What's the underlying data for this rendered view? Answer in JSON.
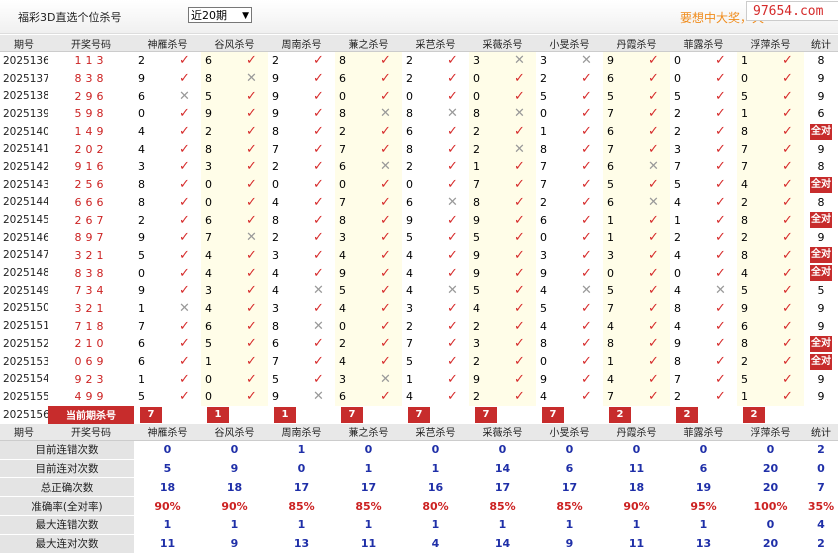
{
  "header": {
    "title": "福彩3D直选个位杀号",
    "range": "近20期",
    "slogan": "要想中大奖，天",
    "logo": "97654.com"
  },
  "columns": {
    "period": "期号",
    "number": "开奖号码",
    "stat": "统计",
    "methods": [
      "神雁杀号",
      "谷风杀号",
      "周南杀号",
      "蒹之杀号",
      "采芑杀号",
      "采薇杀号",
      "小旻杀号",
      "丹霞杀号",
      "菲露杀号",
      "浮萍杀号"
    ]
  },
  "rows": [
    {
      "period": "2025136",
      "number": "113",
      "values": [
        2,
        6,
        2,
        8,
        2,
        3,
        3,
        9,
        0,
        1
      ],
      "marks": [
        1,
        1,
        1,
        1,
        1,
        0,
        0,
        1,
        1,
        1
      ],
      "stat": "8"
    },
    {
      "period": "2025137",
      "number": "838",
      "values": [
        9,
        8,
        9,
        6,
        2,
        0,
        2,
        6,
        0,
        0
      ],
      "marks": [
        1,
        0,
        1,
        1,
        1,
        1,
        1,
        1,
        1,
        1
      ],
      "stat": "9"
    },
    {
      "period": "2025138",
      "number": "296",
      "values": [
        6,
        5,
        9,
        0,
        0,
        0,
        5,
        5,
        5,
        5
      ],
      "marks": [
        0,
        1,
        1,
        1,
        1,
        1,
        1,
        1,
        1,
        1
      ],
      "stat": "9"
    },
    {
      "period": "2025139",
      "number": "598",
      "values": [
        0,
        9,
        9,
        8,
        8,
        8,
        0,
        7,
        2,
        1
      ],
      "marks": [
        1,
        1,
        1,
        0,
        0,
        0,
        1,
        1,
        1,
        1
      ],
      "stat": "6"
    },
    {
      "period": "2025140",
      "number": "149",
      "values": [
        4,
        2,
        8,
        2,
        6,
        2,
        1,
        6,
        2,
        8
      ],
      "marks": [
        1,
        1,
        1,
        1,
        1,
        1,
        1,
        1,
        1,
        1
      ],
      "stat": "全对"
    },
    {
      "period": "2025141",
      "number": "202",
      "values": [
        4,
        8,
        7,
        7,
        8,
        2,
        8,
        7,
        3,
        7
      ],
      "marks": [
        1,
        1,
        1,
        1,
        1,
        0,
        1,
        1,
        1,
        1
      ],
      "stat": "9"
    },
    {
      "period": "2025142",
      "number": "916",
      "values": [
        3,
        3,
        2,
        6,
        2,
        1,
        7,
        6,
        7,
        7
      ],
      "marks": [
        1,
        1,
        1,
        0,
        1,
        1,
        1,
        0,
        1,
        1
      ],
      "stat": "8"
    },
    {
      "period": "2025143",
      "number": "256",
      "values": [
        8,
        0,
        0,
        0,
        0,
        7,
        7,
        5,
        5,
        4
      ],
      "marks": [
        1,
        1,
        1,
        1,
        1,
        1,
        1,
        1,
        1,
        1
      ],
      "stat": "全对"
    },
    {
      "period": "2025144",
      "number": "666",
      "values": [
        8,
        0,
        4,
        7,
        6,
        8,
        2,
        6,
        4,
        2
      ],
      "marks": [
        1,
        1,
        1,
        1,
        0,
        1,
        1,
        0,
        1,
        1
      ],
      "stat": "8"
    },
    {
      "period": "2025145",
      "number": "267",
      "values": [
        2,
        6,
        8,
        8,
        9,
        9,
        6,
        1,
        1,
        8
      ],
      "marks": [
        1,
        1,
        1,
        1,
        1,
        1,
        1,
        1,
        1,
        1
      ],
      "stat": "全对"
    },
    {
      "period": "2025146",
      "number": "897",
      "values": [
        9,
        7,
        2,
        3,
        5,
        5,
        0,
        1,
        2,
        2
      ],
      "marks": [
        1,
        0,
        1,
        1,
        1,
        1,
        1,
        1,
        1,
        1
      ],
      "stat": "9"
    },
    {
      "period": "2025147",
      "number": "321",
      "values": [
        5,
        4,
        3,
        4,
        4,
        9,
        3,
        3,
        4,
        8
      ],
      "marks": [
        1,
        1,
        1,
        1,
        1,
        1,
        1,
        1,
        1,
        1
      ],
      "stat": "全对"
    },
    {
      "period": "2025148",
      "number": "838",
      "values": [
        0,
        4,
        4,
        9,
        4,
        9,
        9,
        0,
        0,
        4
      ],
      "marks": [
        1,
        1,
        1,
        1,
        1,
        1,
        1,
        1,
        1,
        1
      ],
      "stat": "全对"
    },
    {
      "period": "2025149",
      "number": "734",
      "values": [
        9,
        3,
        4,
        5,
        4,
        5,
        4,
        5,
        4,
        5
      ],
      "marks": [
        1,
        1,
        0,
        1,
        0,
        1,
        0,
        1,
        0,
        1
      ],
      "stat": "5"
    },
    {
      "period": "2025150",
      "number": "321",
      "values": [
        1,
        4,
        3,
        4,
        3,
        4,
        5,
        7,
        8,
        9
      ],
      "marks": [
        0,
        1,
        1,
        1,
        1,
        1,
        1,
        1,
        1,
        1
      ],
      "stat": "9"
    },
    {
      "period": "2025151",
      "number": "718",
      "values": [
        7,
        6,
        8,
        0,
        2,
        2,
        4,
        4,
        4,
        6
      ],
      "marks": [
        1,
        1,
        0,
        1,
        1,
        1,
        1,
        1,
        1,
        1
      ],
      "stat": "9"
    },
    {
      "period": "2025152",
      "number": "210",
      "values": [
        6,
        5,
        6,
        2,
        7,
        3,
        8,
        8,
        9,
        8
      ],
      "marks": [
        1,
        1,
        1,
        1,
        1,
        1,
        1,
        1,
        1,
        1
      ],
      "stat": "全对"
    },
    {
      "period": "2025153",
      "number": "069",
      "values": [
        6,
        1,
        7,
        4,
        5,
        2,
        0,
        1,
        8,
        2
      ],
      "marks": [
        1,
        1,
        1,
        1,
        1,
        1,
        1,
        1,
        1,
        1
      ],
      "stat": "全对"
    },
    {
      "period": "2025154",
      "number": "923",
      "values": [
        1,
        0,
        5,
        3,
        1,
        9,
        9,
        4,
        7,
        5
      ],
      "marks": [
        1,
        1,
        1,
        0,
        1,
        1,
        1,
        1,
        1,
        1
      ],
      "stat": "9"
    },
    {
      "period": "2025155",
      "number": "499",
      "values": [
        5,
        0,
        9,
        6,
        4,
        2,
        4,
        7,
        2,
        1
      ],
      "marks": [
        1,
        1,
        0,
        1,
        1,
        1,
        1,
        1,
        1,
        1
      ],
      "stat": "9"
    }
  ],
  "current": {
    "period": "2025156",
    "label": "当前期杀号",
    "values": [
      7,
      1,
      1,
      7,
      7,
      7,
      7,
      2,
      2,
      2
    ]
  },
  "stats": [
    {
      "label": "目前连错次数",
      "values": [
        "0",
        "0",
        "1",
        "0",
        "0",
        "0",
        "0",
        "0",
        "0",
        "0"
      ],
      "stat": "2"
    },
    {
      "label": "目前连对次数",
      "values": [
        "5",
        "9",
        "0",
        "1",
        "1",
        "14",
        "6",
        "11",
        "6",
        "20"
      ],
      "stat": "0"
    },
    {
      "label": "总正确次数",
      "values": [
        "18",
        "18",
        "17",
        "17",
        "16",
        "17",
        "17",
        "18",
        "19",
        "20"
      ],
      "stat": "7"
    },
    {
      "label": "准确率(全对率)",
      "values": [
        "90%",
        "90%",
        "85%",
        "85%",
        "80%",
        "85%",
        "85%",
        "90%",
        "95%",
        "100%"
      ],
      "stat": "35%"
    },
    {
      "label": "最大连错次数",
      "values": [
        "1",
        "1",
        "1",
        "1",
        "1",
        "1",
        "1",
        "1",
        "1",
        "0"
      ],
      "stat": "4"
    },
    {
      "label": "最大连对次数",
      "values": [
        "11",
        "9",
        "13",
        "11",
        "4",
        "14",
        "9",
        "11",
        "13",
        "20"
      ],
      "stat": "2"
    }
  ]
}
